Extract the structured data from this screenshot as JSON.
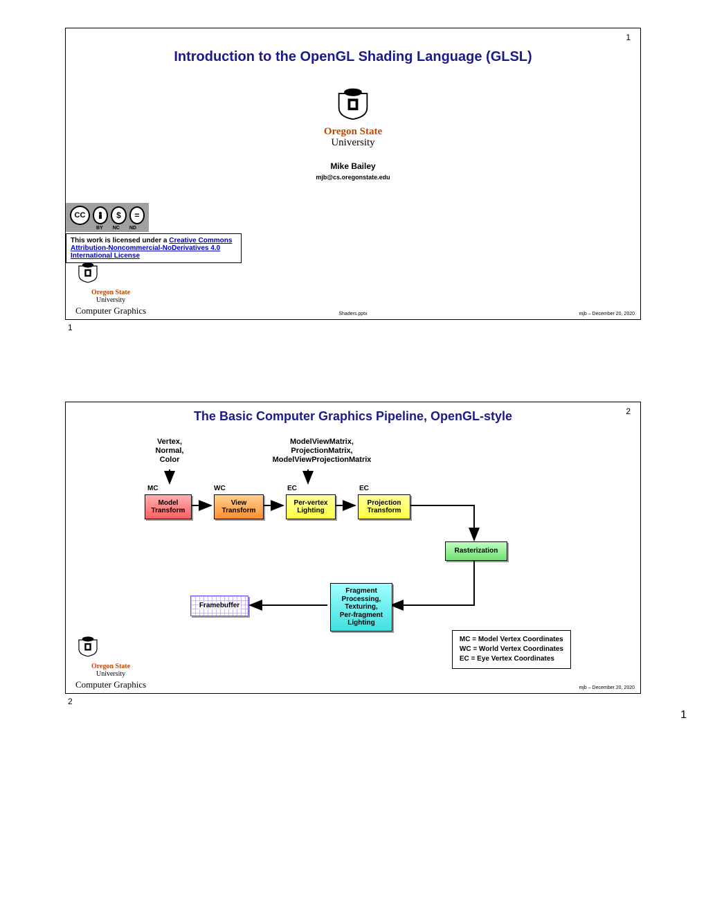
{
  "page_number": "1",
  "slide1": {
    "num": "1",
    "title": "Introduction to the OpenGL Shading Language (GLSL)",
    "osu_state": "Oregon State",
    "osu_univ": "University",
    "author": "Mike Bailey",
    "email": "mjb@cs.oregonstate.edu",
    "lic_pre": "This work is licensed under a ",
    "lic_link": "Creative Commons Attribution-Noncommercial-NoDerivatives 4.0 International License",
    "cc_by": "BY",
    "cc_nc": "NC",
    "cc_nd": "ND",
    "cg": "Computer Graphics",
    "file": "Shaders.pptx",
    "date": "mjb – December 20, 2020"
  },
  "slide2": {
    "num": "2",
    "title": "The Basic Computer Graphics Pipeline, OpenGL-style",
    "in1": "Vertex,\nNormal,\nColor",
    "in2": "ModelViewMatrix,\nProjectionMatrix,\nModelViewProjectionMatrix",
    "mc": "MC",
    "wc": "WC",
    "ec": "EC",
    "model": "Model\nTransform",
    "view": "View\nTransform",
    "pvl": "Per-vertex\nLighting",
    "proj": "Projection\nTransform",
    "rast": "Rasterization",
    "frag": "Fragment\nProcessing,\nTexturing,\nPer-fragment\nLighting",
    "fb": "Framebuffer",
    "legend": "MC = Model Vertex Coordinates\nWC = World Vertex Coordinates\nEC = Eye Vertex Coordinates",
    "osu_state": "Oregon State",
    "osu_univ": "University",
    "cg": "Computer Graphics",
    "date": "mjb – December 20, 2020"
  }
}
